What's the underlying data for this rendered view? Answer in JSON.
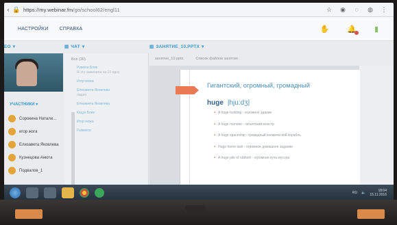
{
  "browser": {
    "url_host": "https://my.webinar.fm",
    "url_path": "/go/school62/engl11"
  },
  "menu": {
    "settings": "НАСТРОЙКИ",
    "help": "СПРАВКА"
  },
  "panels": {
    "video_label": "ЕО",
    "chat_label": "ЧАТ",
    "lesson_label": "ЗАНЯТИЕ_10.PPTX",
    "participants_label": "УЧАСТНИКИ"
  },
  "chat": {
    "filter": "Все (30)",
    "messages": [
      {
        "author": "Руминa Блик",
        "text": "Я эту заменила на 10 одну"
      },
      {
        "author": "Игор можа",
        "text": ""
      },
      {
        "author": "Елизавета Яковлева",
        "text": "ладно"
      },
      {
        "author": "Елизавета Яковлева",
        "text": ""
      },
      {
        "author": "Кицук Блик",
        "text": ""
      },
      {
        "author": "Игор можа",
        "text": ""
      },
      {
        "author": "Рыжиков",
        "text": ""
      }
    ]
  },
  "participants": [
    {
      "name": "Сорокина Натали..."
    },
    {
      "name": "игор жога"
    },
    {
      "name": "Елизавета Яковлева"
    },
    {
      "name": "Кузнецова Анюта"
    },
    {
      "name": "Подвалов_1"
    }
  ],
  "slide": {
    "tab_file": "занятие_10.pptx",
    "tab_label": "Список файлов занятия",
    "title": "Гигантский, огромный, громадный",
    "word": "huge",
    "transcription": "|hju:dʒ|",
    "examples": [
      "A huge building - огромное здание",
      "A huge monster - гигантский монстр",
      "A huge spaceship - громадный космический корабль",
      "Huge home task - огромное домашнее задание",
      "A huge pile of rubbish - огромная куча мусора"
    ]
  },
  "taskbar": {
    "time": "18:04",
    "date": "15.11.2016",
    "lang": "RU"
  }
}
